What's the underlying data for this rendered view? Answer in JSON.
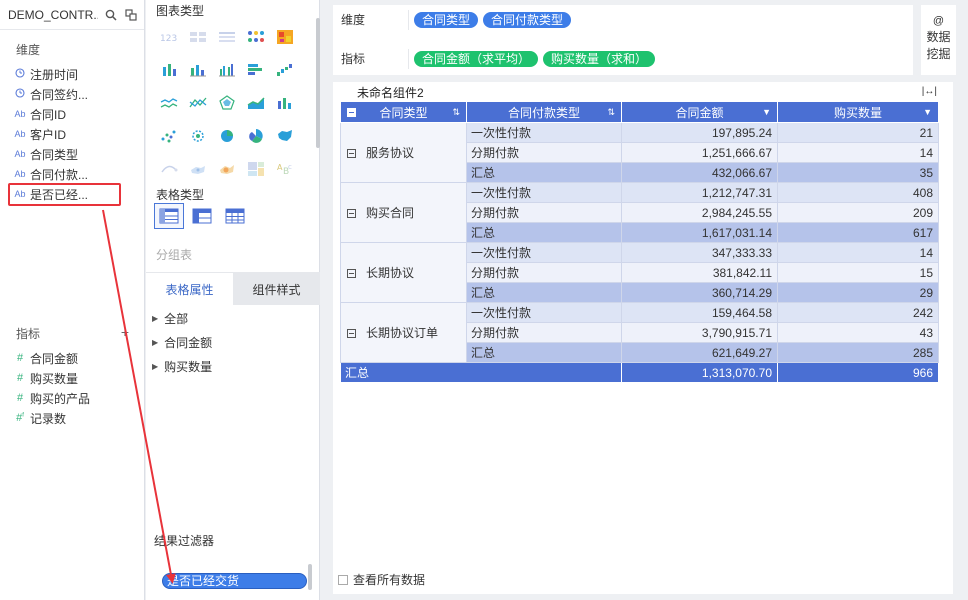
{
  "datasource": {
    "name": "DEMO_CONTR..."
  },
  "dimensions": {
    "title": "维度",
    "items": [
      {
        "icon": "clock-icon",
        "label": "注册时间"
      },
      {
        "icon": "clock-icon",
        "label": "合同签约..."
      },
      {
        "icon": "text-field-icon",
        "label": "合同ID"
      },
      {
        "icon": "text-field-icon",
        "label": "客户ID"
      },
      {
        "icon": "text-field-icon",
        "label": "合同类型"
      },
      {
        "icon": "text-field-icon",
        "label": "合同付款..."
      },
      {
        "icon": "text-field-icon",
        "label": "是否已经..."
      }
    ]
  },
  "metrics": {
    "title": "指标",
    "add_symbol": "+",
    "items": [
      {
        "icon": "number-field-icon",
        "label": "合同金额"
      },
      {
        "icon": "number-field-icon",
        "label": "购买数量"
      },
      {
        "icon": "number-field-icon",
        "label": "购买的产品"
      },
      {
        "icon": "calc-field-icon",
        "label": "记录数"
      }
    ]
  },
  "config": {
    "chart_type_title": "图表类型",
    "table_type_title": "表格类型",
    "group_table_label": "分组表",
    "tabs": {
      "properties": "表格属性",
      "style": "组件样式"
    },
    "props": [
      "全部",
      "合同金额",
      "购买数量"
    ],
    "filter_title": "结果过滤器",
    "filter_pill": "是否已经交货"
  },
  "shelves": {
    "dimension_label": "维度",
    "dimension_pills": [
      "合同类型",
      "合同付款类型"
    ],
    "metric_label": "指标",
    "metric_pills": [
      "合同金额（求平均）",
      "购买数量（求和）"
    ]
  },
  "mining": {
    "at": "@",
    "label_1": "数据",
    "label_2": "挖掘"
  },
  "widget": {
    "title": "未命名组件2",
    "expand_symbol": "|↔|",
    "headers": [
      "合同类型",
      "合同付款类型",
      "合同金额",
      "购买数量"
    ],
    "groups": [
      {
        "name": "服务协议",
        "rows": [
          {
            "sub": "一次性付款",
            "amount": "197,895.24",
            "qty": "21"
          },
          {
            "sub": "分期付款",
            "amount": "1,251,666.67",
            "qty": "14"
          },
          {
            "sub": "汇总",
            "amount": "432,066.67",
            "qty": "35"
          }
        ]
      },
      {
        "name": "购买合同",
        "rows": [
          {
            "sub": "一次性付款",
            "amount": "1,212,747.31",
            "qty": "408"
          },
          {
            "sub": "分期付款",
            "amount": "2,984,245.55",
            "qty": "209"
          },
          {
            "sub": "汇总",
            "amount": "1,617,031.14",
            "qty": "617"
          }
        ]
      },
      {
        "name": "长期协议",
        "rows": [
          {
            "sub": "一次性付款",
            "amount": "347,333.33",
            "qty": "14"
          },
          {
            "sub": "分期付款",
            "amount": "381,842.11",
            "qty": "15"
          },
          {
            "sub": "汇总",
            "amount": "360,714.29",
            "qty": "29"
          }
        ]
      },
      {
        "name": "长期协议订单",
        "rows": [
          {
            "sub": "一次性付款",
            "amount": "159,464.58",
            "qty": "242"
          },
          {
            "sub": "分期付款",
            "amount": "3,790,915.71",
            "qty": "43"
          },
          {
            "sub": "汇总",
            "amount": "621,649.27",
            "qty": "285"
          }
        ]
      }
    ],
    "grand_total": {
      "label": "汇总",
      "amount": "1,313,070.70",
      "qty": "966"
    }
  },
  "view_all_label": "查看所有数据",
  "colors": {
    "header_blue": "#4a6fd3",
    "pill_blue": "#3d7de8",
    "pill_green": "#1ec26e",
    "annotation_red": "#e8333a"
  }
}
